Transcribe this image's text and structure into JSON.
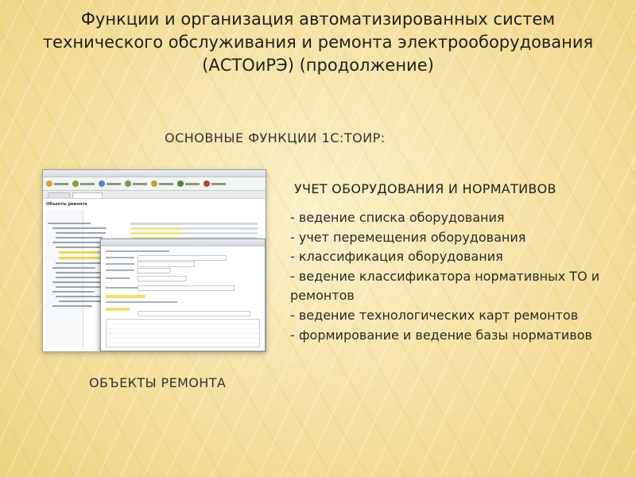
{
  "title": {
    "line1": "Функции и организация автоматизированных систем",
    "line2": "технического обслуживания и ремонта электрооборудования",
    "line3": "(АСТОиРЭ) (продолжение)"
  },
  "section_heading": "ОСНОВНЫЕ ФУНКЦИИ 1С:ТОИР:",
  "sub_heading": "УЧЕТ ОБОРУДОВАНИЯ И НОРМАТИВОВ",
  "bullets": [
    "- ведение списка оборудования",
    "- учет перемещения оборудования",
    "- классификация оборудования",
    "- ведение классификатора нормативных ТО и ремонтов",
    "- ведение технологических карт ремонтов",
    "- формирование и ведение базы нормативов"
  ],
  "caption": "ОБЪЕКТЫ РЕМОНТА",
  "colors": {
    "background": "#f6e7b0",
    "highlight": "#f2d541"
  },
  "screenshot": {
    "form_title": "Объекты ремонта"
  }
}
